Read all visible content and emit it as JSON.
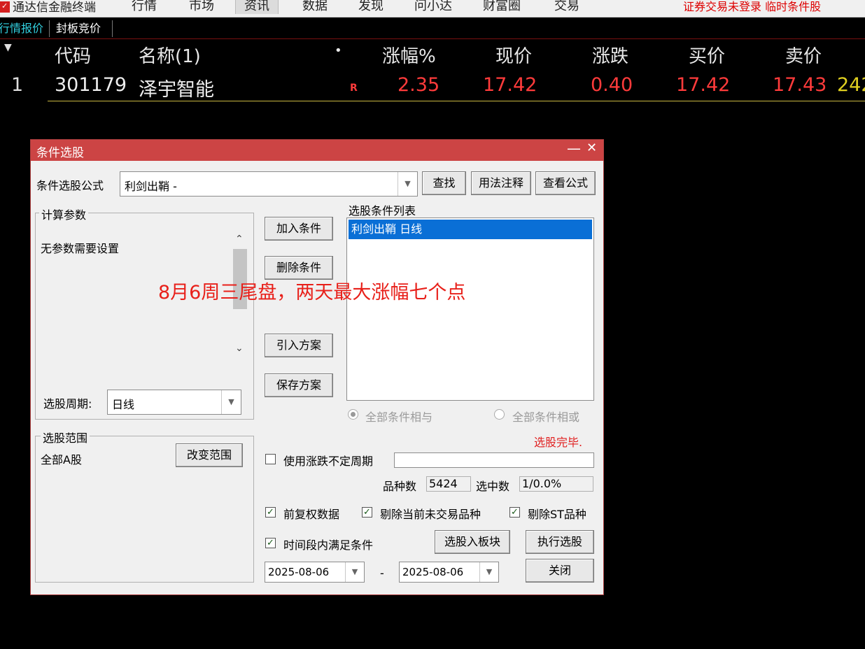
{
  "menubar": {
    "app_title": "通达信金融终端",
    "items": [
      "行情",
      "市场",
      "资讯",
      "数据",
      "发现",
      "问小达",
      "财富圈",
      "交易"
    ],
    "active": "资讯",
    "status": "证券交易未登录  临时条件股"
  },
  "subtabs": [
    "行情报价",
    "封板竞价"
  ],
  "table": {
    "headers": [
      "代码",
      "名称(1)",
      "•",
      "涨幅%",
      "现价",
      "涨跌",
      "买价",
      "卖价"
    ],
    "row": {
      "index": "1",
      "code": "301179",
      "name": "泽宇智能",
      "flag": "R",
      "change_pct": "2.35",
      "price": "17.42",
      "change": "0.40",
      "bid": "17.42",
      "ask": "17.43",
      "extra": "242"
    }
  },
  "dialog": {
    "title": "条件选股",
    "formula_label": "条件选股公式",
    "formula_value": "利剑出鞘  -",
    "btn_find": "查找",
    "btn_usage": "用法注释",
    "btn_view_formula": "查看公式",
    "params_group": "计算参数",
    "params_text": "无参数需要设置",
    "period_label": "选股周期:",
    "period_value": "日线",
    "range_group": "选股范围",
    "range_value": "全部A股",
    "btn_change_range": "改变范围",
    "btn_add": "加入条件",
    "btn_delete": "删除条件",
    "btn_import": "引入方案",
    "btn_save": "保存方案",
    "list_label": "选股条件列表",
    "list_items": [
      "利剑出鞘  日线"
    ],
    "radio_and": "全部条件相与",
    "radio_or": "全部条件相或",
    "status_text": "选股完毕.",
    "chk_variable_period": "使用涨跌不定周期",
    "count_label": "品种数",
    "count_value": "5424",
    "selected_label": "选中数",
    "selected_value": "1/0.0%",
    "chk_fwd_adjust": "前复权数据",
    "chk_exclude_untraded": "剔除当前未交易品种",
    "chk_exclude_st": "剔除ST品种",
    "chk_time_range": "时间段内满足条件",
    "btn_to_block": "选股入板块",
    "btn_execute": "执行选股",
    "date_from": "2025-08-06",
    "date_sep": "-",
    "date_to": "2025-08-06",
    "btn_close": "关闭"
  },
  "annotation": "8月6周三尾盘，两天最大涨幅七个点",
  "colors": {
    "up_red": "#ff3b3b",
    "title_red": "#cc4444",
    "selection_blue": "#0a6fd6",
    "tab_cyan": "#32d0e0"
  }
}
